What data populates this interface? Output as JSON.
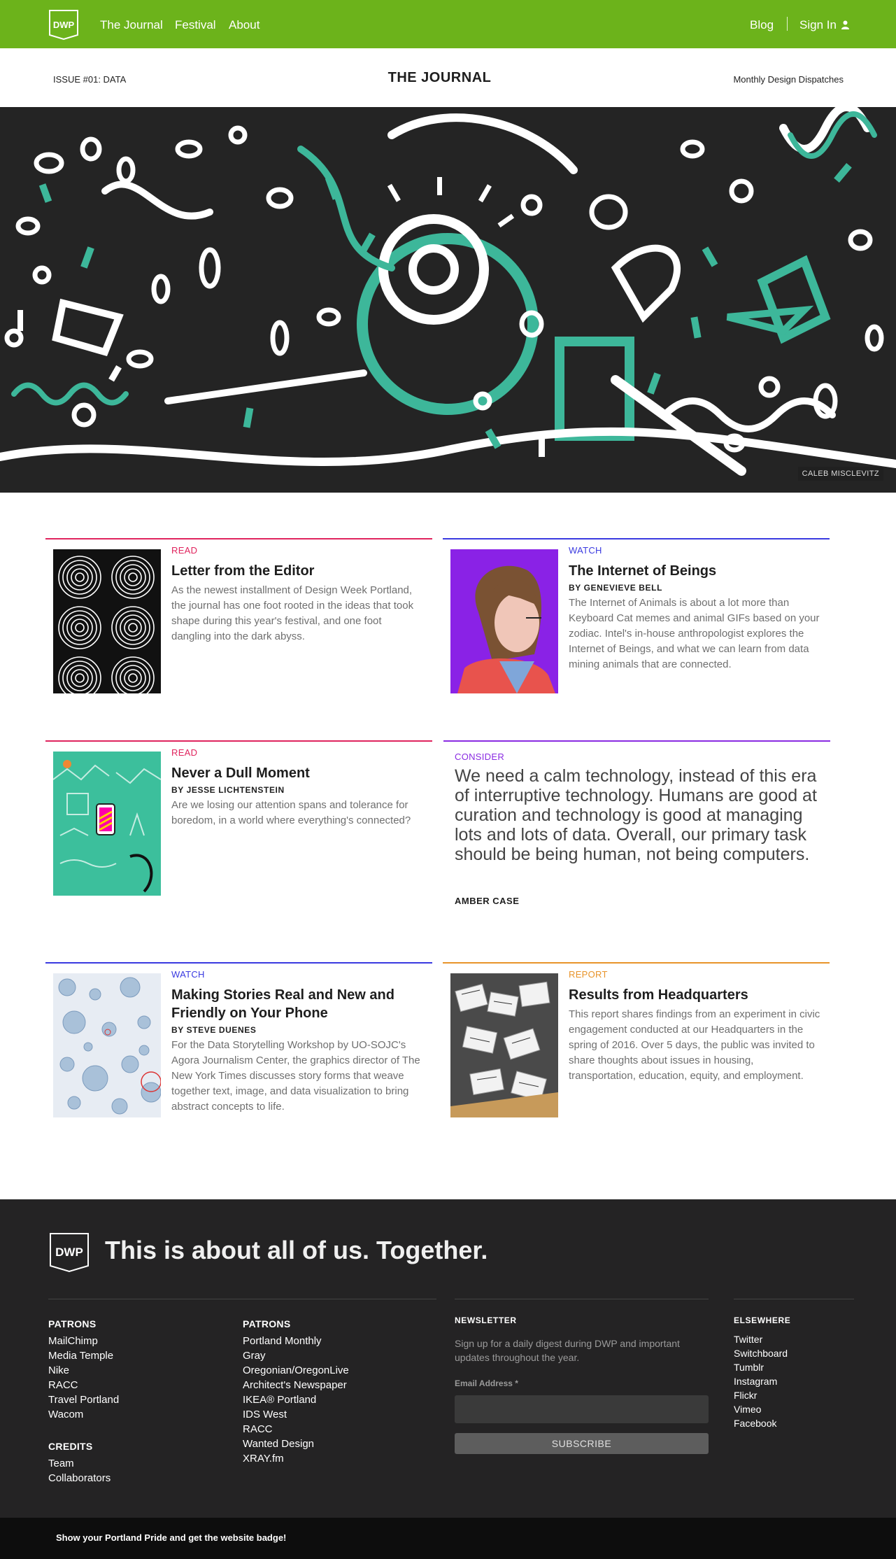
{
  "nav": {
    "links": [
      "The Journal",
      "Festival",
      "About"
    ],
    "blog": "Blog",
    "sign_in": "Sign In",
    "brand_color": "#6cb31b"
  },
  "issue_bar": {
    "issue": "ISSUE #01: DATA",
    "title": "THE JOURNAL",
    "tag": "Monthly Design Dispatches"
  },
  "hero": {
    "credit": "CALEB MISCLEVITZ",
    "colors": {
      "bg": "#242424",
      "teal": "#3db79a",
      "white": "#ffffff"
    }
  },
  "cards": [
    {
      "kicker": "READ",
      "kicker_color": "#e0245e",
      "title": "Letter from the Editor",
      "byline": "",
      "text": "As the newest installment of Design Week Portland, the journal has one foot rooted in the ideas that took shape during this year's festival, and one foot dangling into the dark abyss."
    },
    {
      "kicker": "WATCH",
      "kicker_color": "#3a3ae0",
      "title": "The Internet of Beings",
      "byline": "BY GENEVIEVE BELL",
      "text": "The Internet of Animals is about a lot more than Keyboard Cat memes and animal GIFs based on your zodiac. Intel's in-house anthropologist explores the Internet of Beings, and what we can learn from data mining animals that are connected."
    },
    {
      "kicker": "READ",
      "kicker_color": "#e0245e",
      "title": "Never a Dull Moment",
      "byline": "BY JESSE LICHTENSTEIN",
      "text": "Are we losing our attention spans and tolerance for boredom, in a world where everything's connected?"
    },
    {
      "kicker": "WATCH",
      "kicker_color": "#3a3ae0",
      "title": "Making Stories Real and New and Friendly on Your Phone",
      "byline": "BY STEVE DUENES",
      "text": "For the Data Storytelling Workshop by UO-SOJC's Agora Journalism Center, the graphics director of The New York Times discusses story forms that weave together text, image, and data visualization to bring abstract concepts to life."
    },
    {
      "kicker": "REPORT",
      "kicker_color": "#e8942a",
      "title": "Results from Headquarters",
      "byline": "",
      "text": "This report shares findings from an experiment in civic engagement conducted at our Headquarters in the spring of 2016. Over 5 days, the public was invited to share thoughts about issues in housing, transportation, education, equity, and employment."
    }
  ],
  "quote": {
    "kicker": "CONSIDER",
    "kicker_color": "#8a2be2",
    "text": "We need a calm technology, instead of this era of interruptive technology. Humans are good at curation and technology is good at managing lots and lots of data. Overall, our primary task should be being human, not being computers.",
    "author": "AMBER CASE"
  },
  "footer": {
    "tagline": "This is about all of us. Together.",
    "patrons_1": {
      "heading": "PATRONS",
      "items": [
        "MailChimp",
        "Media Temple",
        "Nike",
        "RACC",
        "Travel Portland",
        "Wacom"
      ]
    },
    "credits": {
      "heading": "CREDITS",
      "items": [
        "Team",
        "Collaborators"
      ]
    },
    "patrons_2": {
      "heading": "PATRONS",
      "items": [
        "Portland Monthly",
        "Gray",
        "Oregonian/OregonLive",
        "Architect's Newspaper",
        "IKEA® Portland",
        "IDS West",
        "RACC",
        "Wanted Design",
        "XRAY.fm"
      ]
    },
    "newsletter": {
      "heading": "NEWSLETTER",
      "description": "Sign up for a daily digest during DWP and important updates throughout the year.",
      "email_label": "Email Address *",
      "subscribe": "SUBSCRIBE"
    },
    "elsewhere": {
      "heading": "ELSEWHERE",
      "items": [
        "Twitter",
        "Switchboard",
        "Tumblr",
        "Instagram",
        "Flickr",
        "Vimeo",
        "Facebook"
      ]
    }
  },
  "bottom_bar": {
    "text": "Show your Portland Pride and get the website badge!"
  }
}
